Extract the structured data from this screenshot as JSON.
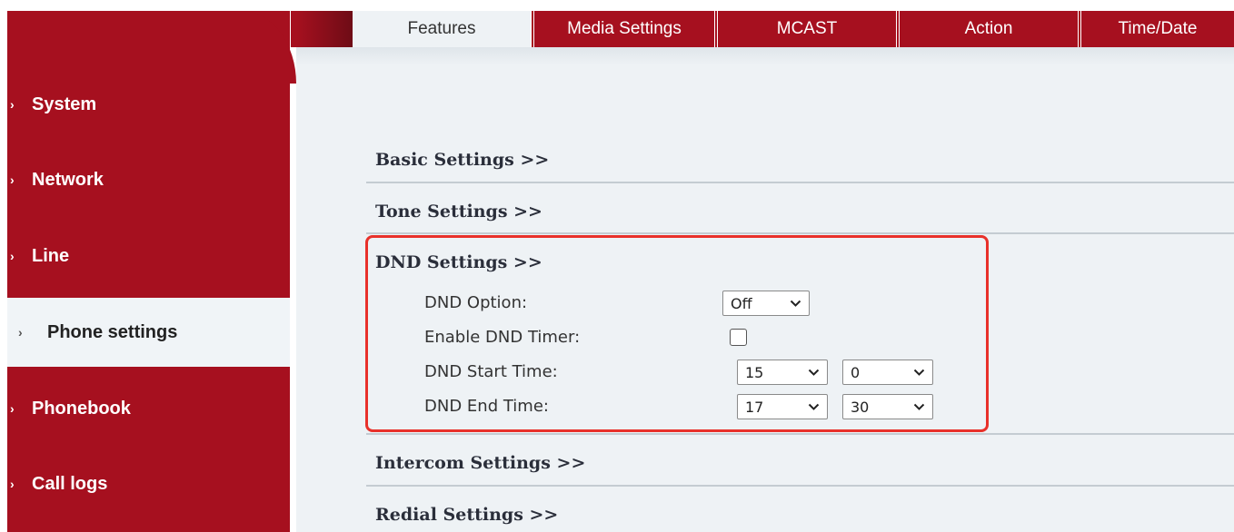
{
  "sidebar": {
    "items": [
      {
        "label": "System"
      },
      {
        "label": "Network"
      },
      {
        "label": "Line"
      },
      {
        "label": "Phone settings"
      },
      {
        "label": "Phonebook"
      },
      {
        "label": "Call logs"
      }
    ],
    "active": "Phone settings"
  },
  "tabs": [
    {
      "label": "Features"
    },
    {
      "label": "Media Settings"
    },
    {
      "label": "MCAST"
    },
    {
      "label": "Action"
    },
    {
      "label": "Time/Date"
    }
  ],
  "sections": {
    "basic": "Basic Settings >>",
    "tone": "Tone Settings >>",
    "dnd": "DND Settings >>",
    "intercom": "Intercom Settings >>",
    "redial": "Redial Settings >>"
  },
  "dnd": {
    "option_label": "DND Option:",
    "option_value": "Off",
    "timer_label": "Enable DND Timer:",
    "timer_checked": false,
    "start_label": "DND Start Time:",
    "start_hour": "15",
    "start_minute": "0",
    "end_label": "DND End Time:",
    "end_hour": "17",
    "end_minute": "30"
  },
  "colors": {
    "brand": "#a6101f",
    "highlight": "#e8312a",
    "content_bg": "#eef2f5"
  }
}
